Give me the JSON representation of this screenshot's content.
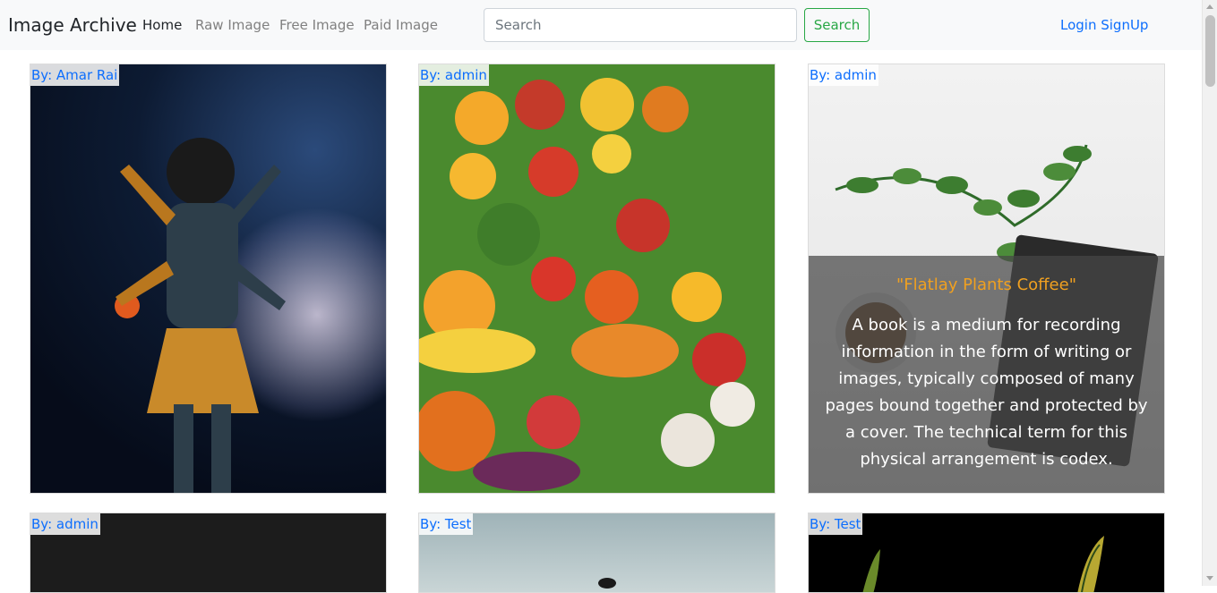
{
  "navbar": {
    "brand": "Image Archive",
    "links": [
      "Home",
      "Raw Image",
      "Free Image",
      "Paid Image"
    ],
    "search_placeholder": "Search",
    "search_button": "Search",
    "auth": "Login SignUp"
  },
  "cards": [
    {
      "author": "By: Amar Rai"
    },
    {
      "author": "By: admin"
    },
    {
      "author": "By: admin",
      "overlay_title": "\"Flatlay Plants Coffee\"",
      "overlay_text": "A book is a medium for recording information in the form of writing or images, typically composed of many pages bound together and protected by a cover. The technical term for this physical arrangement is codex."
    },
    {
      "author": "By: admin"
    },
    {
      "author": "By: Test"
    },
    {
      "author": "By: Test"
    }
  ]
}
